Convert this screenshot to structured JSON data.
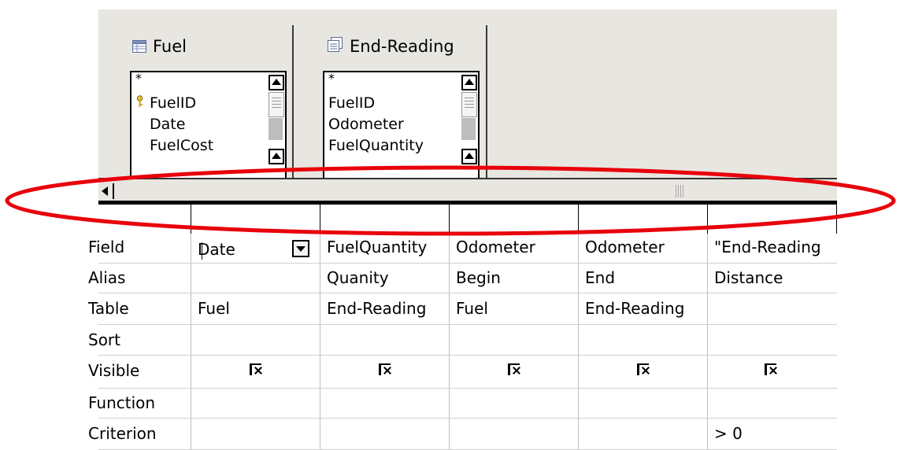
{
  "tables": [
    {
      "name": "Fuel",
      "fields": [
        "*",
        "FuelID",
        "Date",
        "FuelCost"
      ]
    },
    {
      "name": "End-Reading",
      "fields": [
        "*",
        "FuelID",
        "Odometer",
        "FuelQuantity"
      ]
    }
  ],
  "grid": {
    "row_labels": [
      "Field",
      "Alias",
      "Table",
      "Sort",
      "Visible",
      "Function",
      "Criterion"
    ],
    "columns": [
      {
        "field": "Date",
        "alias": "",
        "table": "Fuel",
        "sort": "",
        "visible": true,
        "function": "",
        "criterion": ""
      },
      {
        "field": "FuelQuantity",
        "alias": "Quanity",
        "table": "End-Reading",
        "sort": "",
        "visible": true,
        "function": "",
        "criterion": ""
      },
      {
        "field": "Odometer",
        "alias": "Begin",
        "table": "Fuel",
        "sort": "",
        "visible": true,
        "function": "",
        "criterion": ""
      },
      {
        "field": "Odometer",
        "alias": "End",
        "table": "End-Reading",
        "sort": "",
        "visible": true,
        "function": "",
        "criterion": ""
      },
      {
        "field": "\"End-Reading",
        "alias": "Distance",
        "table": "",
        "sort": "",
        "visible": true,
        "function": "",
        "criterion": "> 0"
      }
    ]
  },
  "colors": {
    "highlight": "#e8000b",
    "panel": "#e8e6e0"
  },
  "icons": {
    "primary_key": "key-icon",
    "table": "table-icon",
    "query": "query-icon"
  }
}
